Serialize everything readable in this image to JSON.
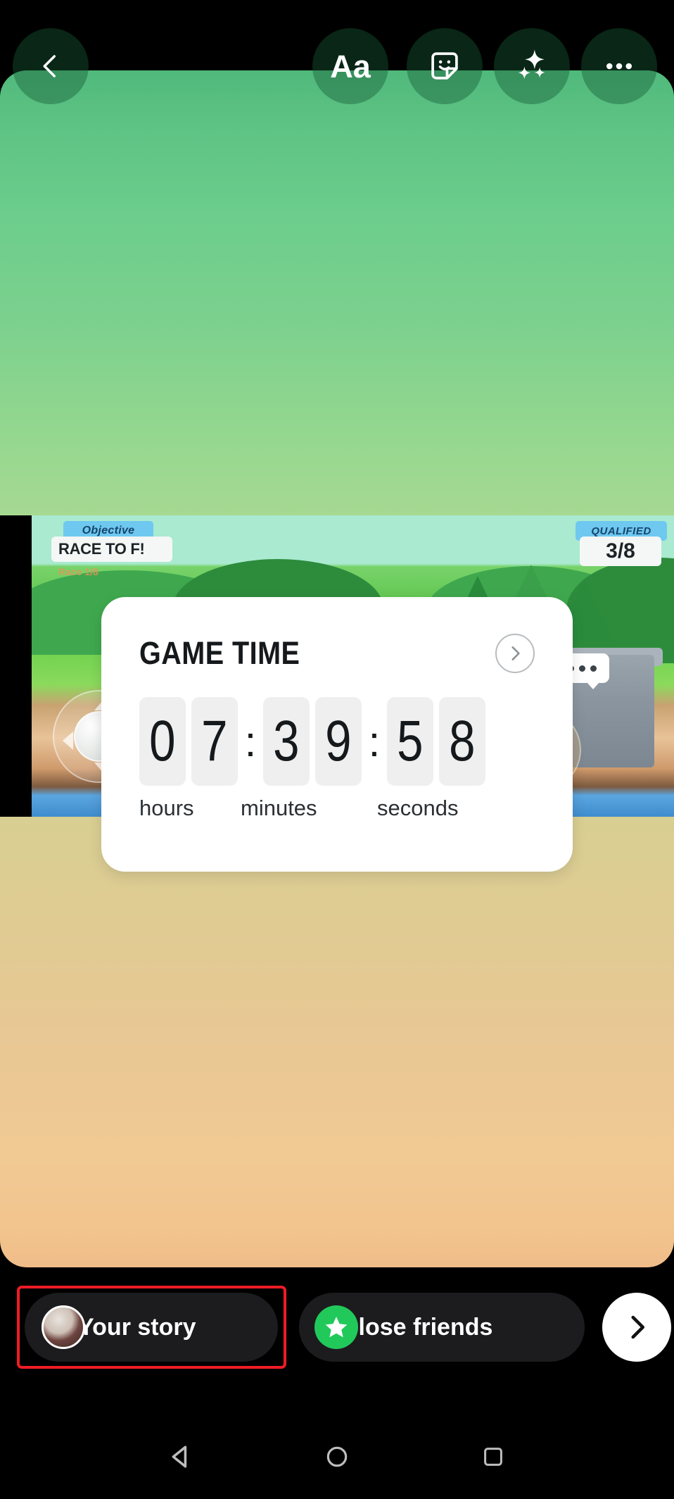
{
  "app": {
    "name": "Instagram Story Editor",
    "platform": "Android"
  },
  "toolbar": {
    "back_label": "Back",
    "back_icon": "chevron-left-icon",
    "text_label": "Aa",
    "text_icon": "text-tool-icon",
    "sticker_label": "Sticker",
    "sticker_icon": "sticker-smiley-icon",
    "sparkle_label": "Effects",
    "sparkle_icon": "sparkles-icon",
    "more_label": "More",
    "more_icon": "three-dots-icon"
  },
  "canvas": {
    "background_type": "gradient",
    "gradient_top_color": "#4fb97b",
    "gradient_mid_color": "#ddcd93",
    "gradient_bottom_color": "#f0bc89"
  },
  "media": {
    "type": "game-screenshot",
    "objective_tag": "Objective",
    "objective_text": "RACE TO F!",
    "objective_sub": "Race 1/8",
    "qualified_tag": "QUALIFIED",
    "qualified_count": "3/8",
    "jump_icon": "up-arrow-icon",
    "chat_icon": "chat-bubble-icon",
    "joystick_icon": "joystick-icon"
  },
  "countdown_sticker": {
    "title": "GAME TIME",
    "next_icon": "chevron-right-icon",
    "separator": ":",
    "hours": [
      "0",
      "7"
    ],
    "minutes": [
      "3",
      "9"
    ],
    "seconds": [
      "5",
      "8"
    ],
    "label_hours": "hours",
    "label_minutes": "minutes",
    "label_seconds": "seconds"
  },
  "action_bar": {
    "your_story_label": "Your story",
    "your_story_avatar": "user-avatar",
    "your_story_highlighted": true,
    "highlight_color": "#ee1c25",
    "close_friends_label": "Close friends",
    "close_friends_icon": "green-star-icon",
    "close_friends_color": "#21c95b",
    "send_label": "Send",
    "send_icon": "chevron-right-icon"
  },
  "navigation_bar": {
    "back_label": "Back",
    "back_icon": "triangle-back-icon",
    "home_label": "Home",
    "home_icon": "circle-home-icon",
    "recents_label": "Recents",
    "recents_icon": "square-recents-icon"
  }
}
